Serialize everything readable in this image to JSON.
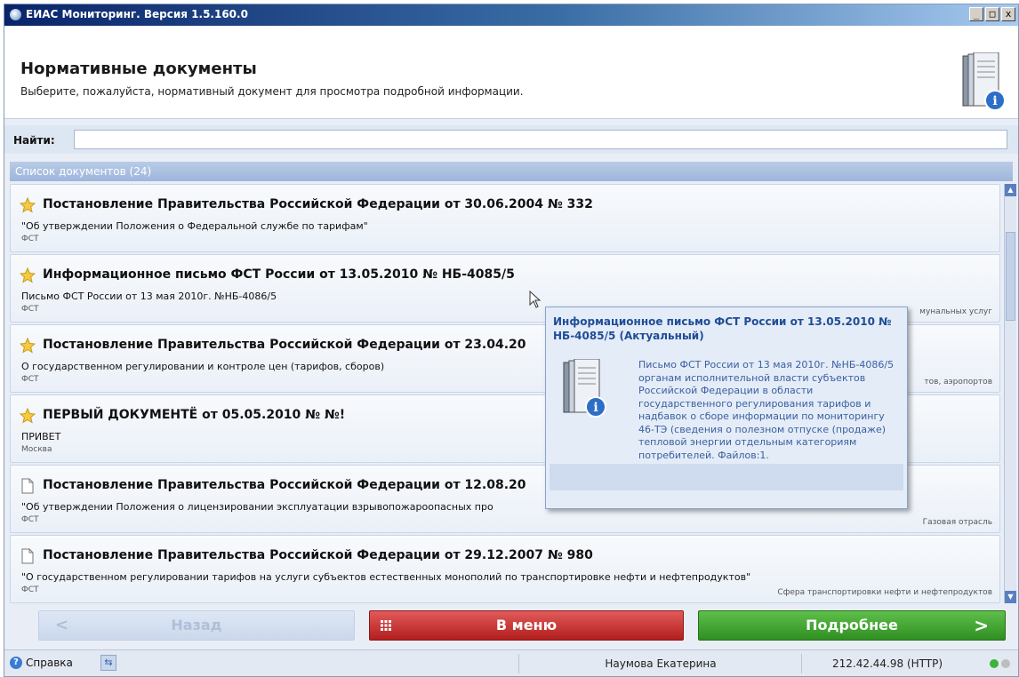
{
  "window": {
    "title": "ЕИАС Мониторинг. Версия 1.5.160.0",
    "controls": {
      "minimize": "_",
      "maximize": "□",
      "close": "x"
    }
  },
  "header": {
    "title": "Нормативные документы",
    "subtitle": "Выберите, пожалуйста, нормативный документ для просмотра подробной информации."
  },
  "search": {
    "label": "Найти:",
    "value": "",
    "placeholder": ""
  },
  "list": {
    "header": "Список документов (24)",
    "items": [
      {
        "icon": "star-icon",
        "title": "Постановление Правительства Российской Федерации от 30.06.2004 № 332",
        "desc": "\"Об утверждении Положения о Федеральной службе по тарифам\"",
        "source": "ФСТ",
        "right": ""
      },
      {
        "icon": "star-icon",
        "title": "Информационное письмо ФСТ России от 13.05.2010 № НБ-4085/5",
        "desc": "Письмо ФСТ России от 13 мая 2010г. №НБ-4086/5",
        "source": "ФСТ",
        "right": "мунальных услуг"
      },
      {
        "icon": "star-icon",
        "title": "Постановление Правительства Российской Федерации от 23.04.20",
        "desc": "О государственном регулировании и контроле цен (тарифов, сборов)",
        "source": "ФСТ",
        "right": "тов, аэропортов"
      },
      {
        "icon": "star-icon",
        "title": "ПЕРВЫЙ ДОКУМЕНТЁ от 05.05.2010 № №!",
        "desc": "ПРИВЕТ",
        "source": "Москва",
        "right": ""
      },
      {
        "icon": "document-icon",
        "title": "Постановление Правительства Российской Федерации от 12.08.20",
        "desc": "\"Об утверждении Положения о лицензировании эксплуатации взрывопожароопасных про",
        "source": "ФСТ",
        "right": "Газовая отрасль"
      },
      {
        "icon": "document-icon",
        "title": "Постановление Правительства Российской Федерации от 29.12.2007 № 980",
        "desc": "\"О государственном регулировании тарифов на услуги субъектов естественных монополий по транспортировке нефти и нефтепродуктов\"",
        "source": "ФСТ",
        "right": "Сфера транспортировки нефти и нефтепродуктов"
      }
    ]
  },
  "tooltip": {
    "title": "Информационное письмо ФСТ России от 13.05.2010 № НБ-4085/5 (Актуальный)",
    "body": "Письмо ФСТ России от 13 мая 2010г. №НБ-4086/5 органам исполнительной власти субъектов Российской Федерации в области государственного регулирования тарифов и надбавок о сборе информации по мониторингу 46-ТЭ (сведения о полезном отпуске (продаже) тепловой энергии отдельным категориям потребителей. Файлов:1."
  },
  "buttons": {
    "back": "Назад",
    "menu": "В меню",
    "more": "Подробнее"
  },
  "statusbar": {
    "help": "Справка",
    "user": "Наумова Екатерина",
    "server": "212.42.44.98 (HTTP)",
    "status_colors": [
      "#3cb43c",
      "#bdbdbd"
    ]
  }
}
